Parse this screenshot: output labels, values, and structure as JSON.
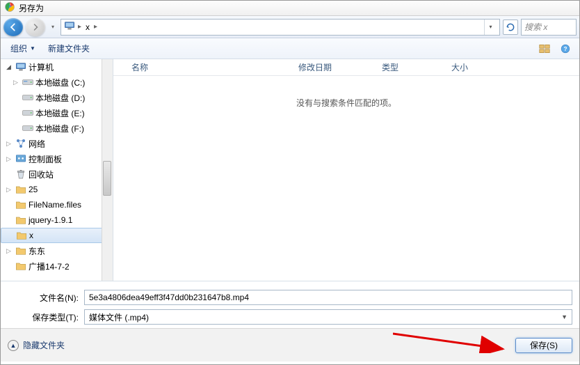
{
  "title": "另存为",
  "address": {
    "crumb": "x"
  },
  "search": {
    "placeholder": "搜索 x"
  },
  "toolbar": {
    "organize": "组织",
    "new_folder": "新建文件夹"
  },
  "tree": {
    "computer": "计算机",
    "drive_c": "本地磁盘 (C:)",
    "drive_d": "本地磁盘 (D:)",
    "drive_e": "本地磁盘 (E:)",
    "drive_f": "本地磁盘 (F:)",
    "network": "网络",
    "control_panel": "控制面板",
    "recycle": "回收站",
    "f_25": "25",
    "f_filename": "FileName.files",
    "f_jquery": "jquery-1.9.1",
    "f_x": "x",
    "f_dd": "东东",
    "f_gb": "广播14-7-2"
  },
  "columns": {
    "name": "名称",
    "date": "修改日期",
    "type": "类型",
    "size": "大小"
  },
  "empty": "没有与搜索条件匹配的项。",
  "filename_label": "文件名(N):",
  "filetype_label": "保存类型(T):",
  "filename_value": "5e3a4806dea49eff3f47dd0b231647b8.mp4",
  "filetype_value": "媒体文件 (.mp4)",
  "hide_folders": "隐藏文件夹",
  "save_label": "保存(S)"
}
